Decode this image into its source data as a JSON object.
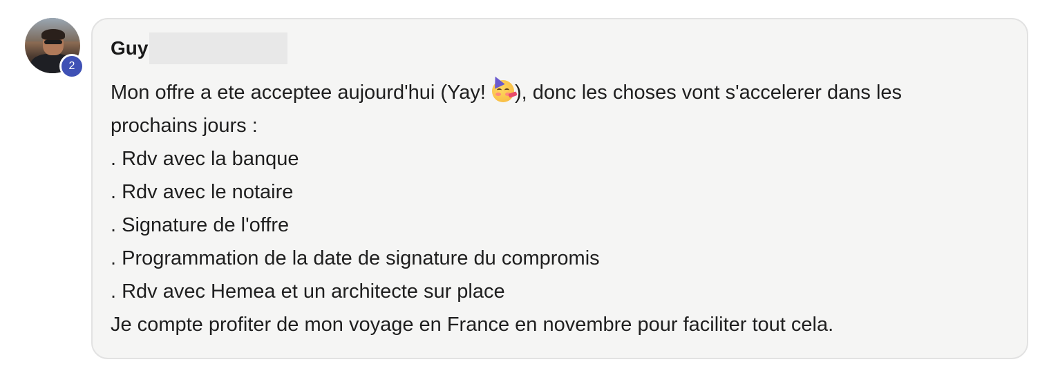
{
  "comment": {
    "author": {
      "name": "Guy",
      "badge_count": "2"
    },
    "lines": [
      {
        "before": "Mon offre a ete acceptee aujourd'hui (Yay! ",
        "emoji": "partying-face-emoji",
        "after": "), donc les choses vont s'accelerer dans les"
      },
      {
        "text": "prochains jours :"
      },
      {
        "text": ". Rdv avec la banque"
      },
      {
        "text": ". Rdv avec le notaire"
      },
      {
        "text": ". Signature de l'offre"
      },
      {
        "text": ". Programmation de la date de signature du compromis"
      },
      {
        "text": ". Rdv avec Hemea et un architecte sur place"
      },
      {
        "text": "Je compte profiter de mon voyage en France en novembre pour faciliter tout cela."
      }
    ]
  },
  "colors": {
    "bubble_background": "#f5f5f4",
    "bubble_border": "#e2e2e2",
    "badge": "#3f51b5",
    "text": "#1f1f1f"
  }
}
